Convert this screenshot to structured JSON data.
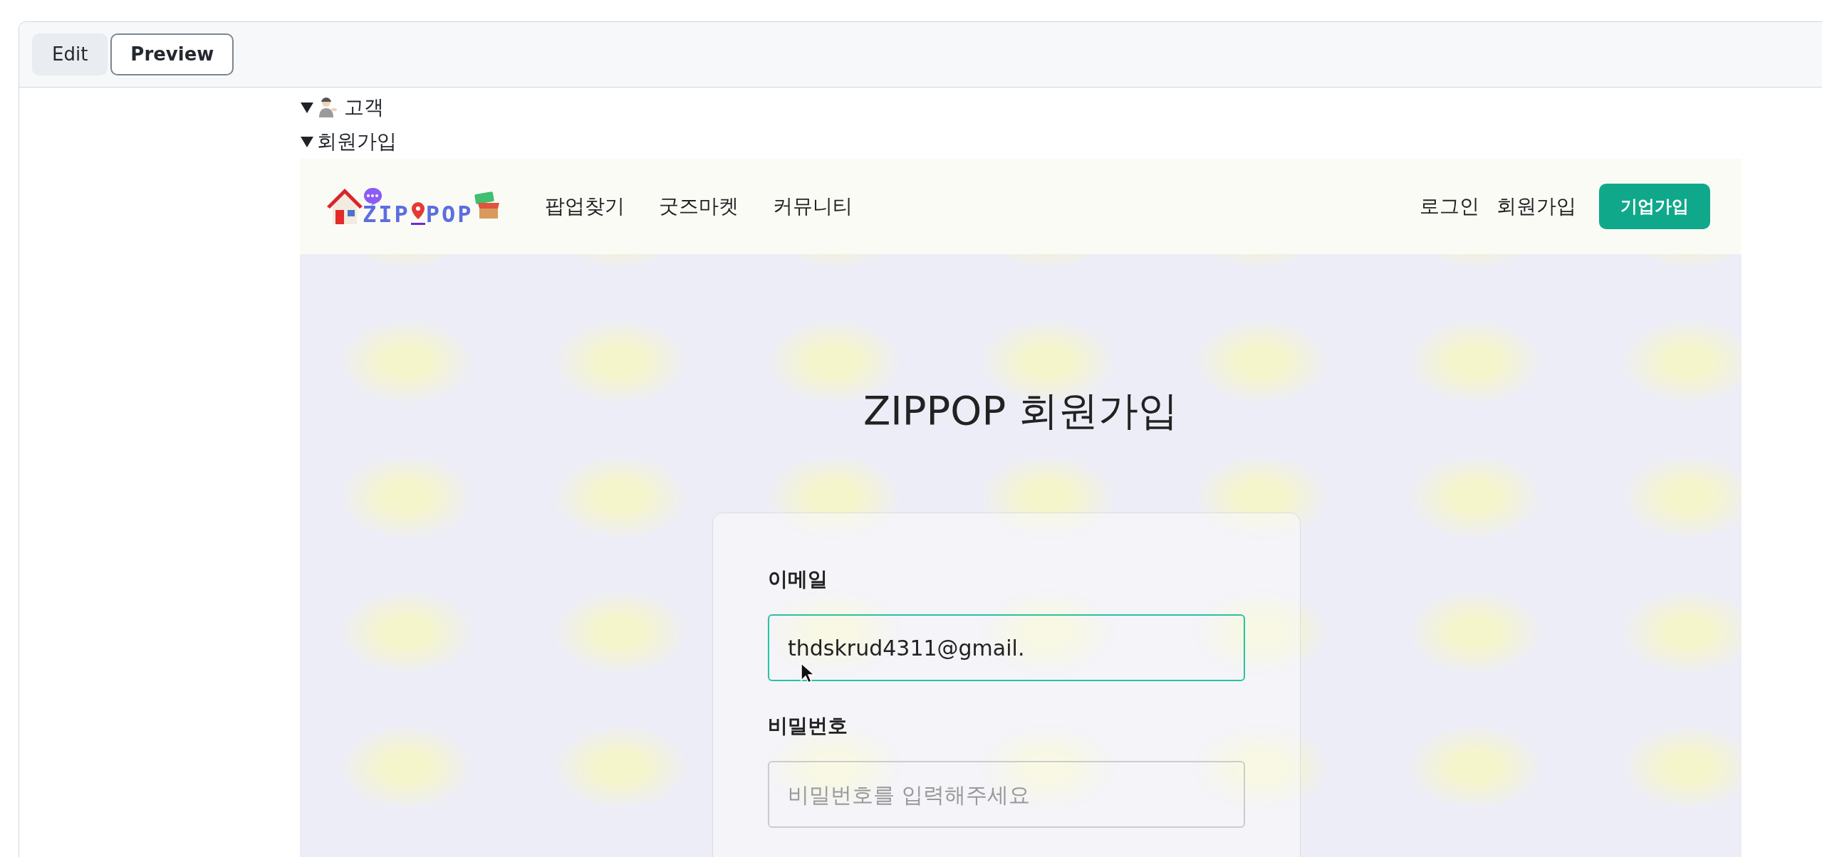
{
  "editor_tabs": [
    {
      "label": "Edit",
      "selected": false
    },
    {
      "label": "Preview",
      "selected": true
    }
  ],
  "outline": [
    {
      "label": "고객",
      "expanded": true,
      "kind": "persona"
    },
    {
      "label": "회원가입",
      "expanded": true,
      "kind": "plain"
    }
  ],
  "navbar": {
    "logo": [
      "ZIP",
      "POP"
    ],
    "links": [
      "팝업찾기",
      "굿즈마켓",
      "커뮤니티"
    ],
    "auth_links": [
      "로그인",
      "회원가입"
    ],
    "cta": "기업가입"
  },
  "page": {
    "title": "ZIPPOP 회원가입",
    "fields": [
      {
        "label": "이메일",
        "value": "thdskrud4311@gmail.",
        "focused": true
      },
      {
        "label": "비밀번호",
        "placeholder": "비밀번호를 입력해주세요",
        "focused": false
      }
    ]
  }
}
